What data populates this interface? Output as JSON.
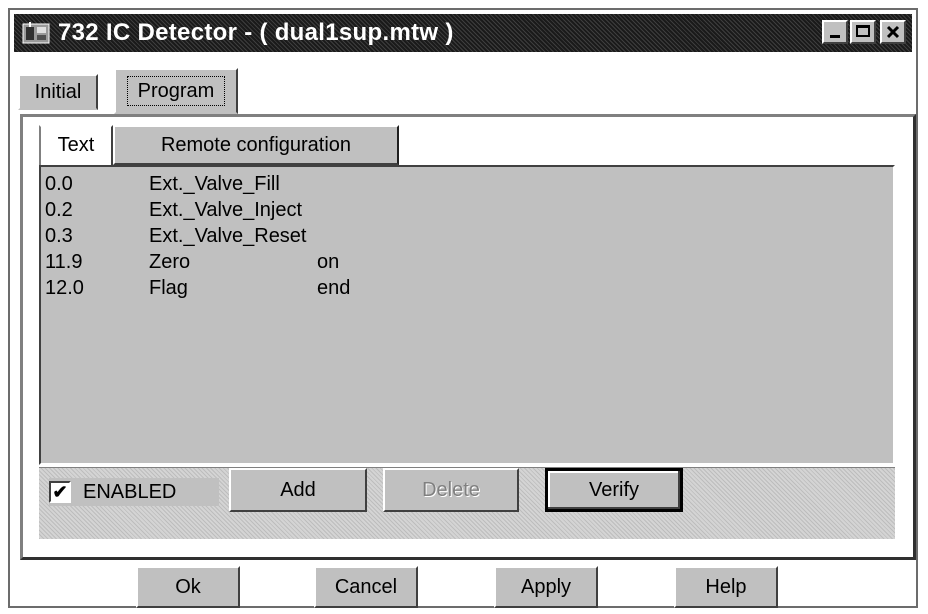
{
  "window": {
    "title": "732 IC Detector - ( dual1sup.mtw )",
    "icon": "app-icon",
    "controls": {
      "minimize": "_",
      "maximize": "□",
      "close": "×"
    }
  },
  "outer_tabs": [
    {
      "label": "Initial",
      "selected": false
    },
    {
      "label": "Program",
      "selected": true
    }
  ],
  "inner_tabs": [
    {
      "label": "Text",
      "selected": true
    },
    {
      "label": "Remote configuration",
      "selected": false
    }
  ],
  "program_lines": [
    {
      "time": "0.0",
      "command": "Ext._Valve_Fill",
      "param": ""
    },
    {
      "time": "0.2",
      "command": "Ext._Valve_Inject",
      "param": ""
    },
    {
      "time": "0.3",
      "command": "Ext._Valve_Reset",
      "param": ""
    },
    {
      "time": "11.9",
      "command": "Zero",
      "param": "on"
    },
    {
      "time": "12.0",
      "command": "Flag",
      "param": "end"
    }
  ],
  "command_bar": {
    "enabled_label": "ENABLED",
    "enabled_checked": true,
    "check_mark": "✔",
    "add": "Add",
    "delete": "Delete",
    "verify": "Verify"
  },
  "dialog_buttons": {
    "ok": "Ok",
    "cancel": "Cancel",
    "apply": "Apply",
    "help": "Help"
  },
  "colors": {
    "face": "#c0c0c0",
    "titlebar": "#1a1a1a",
    "disabled_text": "#808080"
  }
}
